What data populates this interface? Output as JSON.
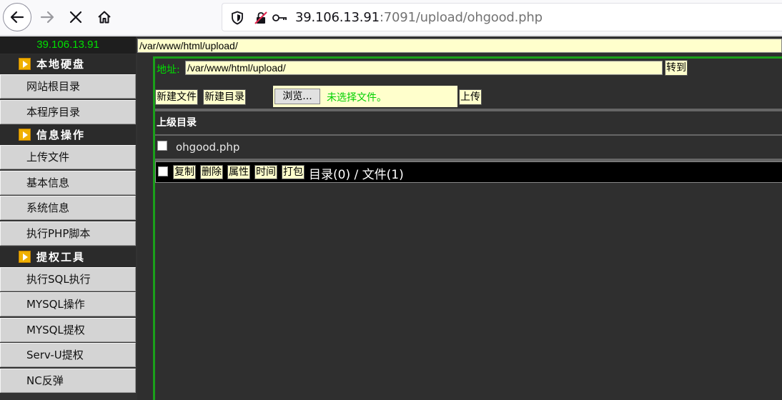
{
  "browser": {
    "url_host": "39.106.13.91",
    "url_rest": ":7091/upload/ohgood.php"
  },
  "header": {
    "ip": "39.106.13.91",
    "path": "/var/www/html/upload/"
  },
  "sidebar": {
    "sections": [
      {
        "title": "本地硬盘",
        "items": [
          "网站根目录",
          "本程序目录"
        ]
      },
      {
        "title": "信息操作",
        "items": [
          "上传文件",
          "基本信息",
          "系统信息",
          "执行PHP脚本"
        ]
      },
      {
        "title": "提权工具",
        "items": [
          "执行SQL执行",
          "MYSQL操作",
          "MYSQL提权",
          "Serv-U提权",
          "NC反弹"
        ]
      }
    ]
  },
  "main": {
    "address_label": "地址:",
    "address_value": "/var/www/html/upload/",
    "go_button": "转到",
    "new_file_button": "新建文件",
    "new_dir_button": "新建目录",
    "browse_button": "浏览...",
    "no_file_selected": "未选择文件。",
    "upload_button": "上传",
    "parent_dir": "上级目录",
    "files": [
      "ohgood.php"
    ],
    "actions": [
      "复制",
      "删除",
      "属性",
      "时间",
      "打包"
    ],
    "stats": "目录(0) / 文件(1)"
  },
  "colors": {
    "accent_green": "#00e000",
    "input_bg": "#ffffcc",
    "panel_bg": "#2f2f2f"
  }
}
